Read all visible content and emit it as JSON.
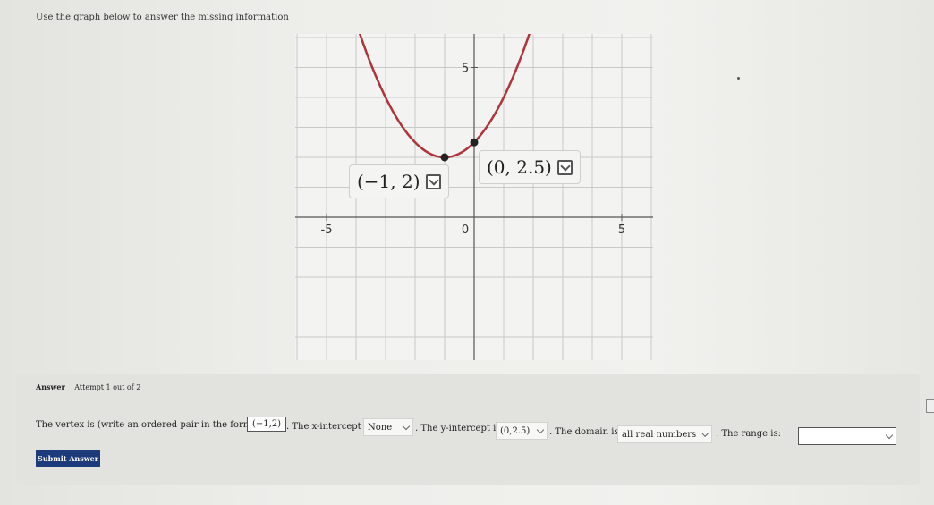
{
  "instructions": "Use the graph below to answer the missing information",
  "chart_data": {
    "type": "line",
    "series": [
      {
        "function": "y = 0.5(x+1)^2 + 2",
        "x": [
          -4.7,
          -4,
          -3,
          -2,
          -1,
          0,
          1,
          2,
          2.1
        ],
        "y": [
          8.85,
          6.5,
          4,
          2.5,
          2,
          2.5,
          4,
          6.5,
          6.8
        ],
        "color": "#b0333b"
      }
    ],
    "points": [
      {
        "x": -1,
        "y": 2,
        "label": "(−1, 2)"
      },
      {
        "x": 0,
        "y": 2.5,
        "label": "(0, 2.5)"
      }
    ],
    "tick_labels": {
      "x_neg": "-5",
      "origin": "0",
      "x_pos": "5",
      "y_pos": "5"
    },
    "xlim": [
      -6,
      6
    ],
    "ylim": [
      -5,
      6
    ],
    "grid": true
  },
  "answer": {
    "heading": "Answer",
    "attempt": "Attempt 1 out of 2",
    "vertex_prompt": "The vertex is (write an ordered pair in the form (x,y)):",
    "vertex_value": "(−1,2)",
    "x_intercept_prompt": ". The x-intercept is:",
    "x_intercept_value": "None",
    "y_intercept_prompt": ". The y-intercept is:",
    "y_intercept_value": "(0,2.5)",
    "domain_prompt": ". The domain is:",
    "domain_value": "all real numbers",
    "range_prompt": ". The range is:",
    "range_value": "",
    "submit_label": "Submit Answer"
  },
  "icons": [
    "edit-icon",
    "chevron-down-icon"
  ]
}
